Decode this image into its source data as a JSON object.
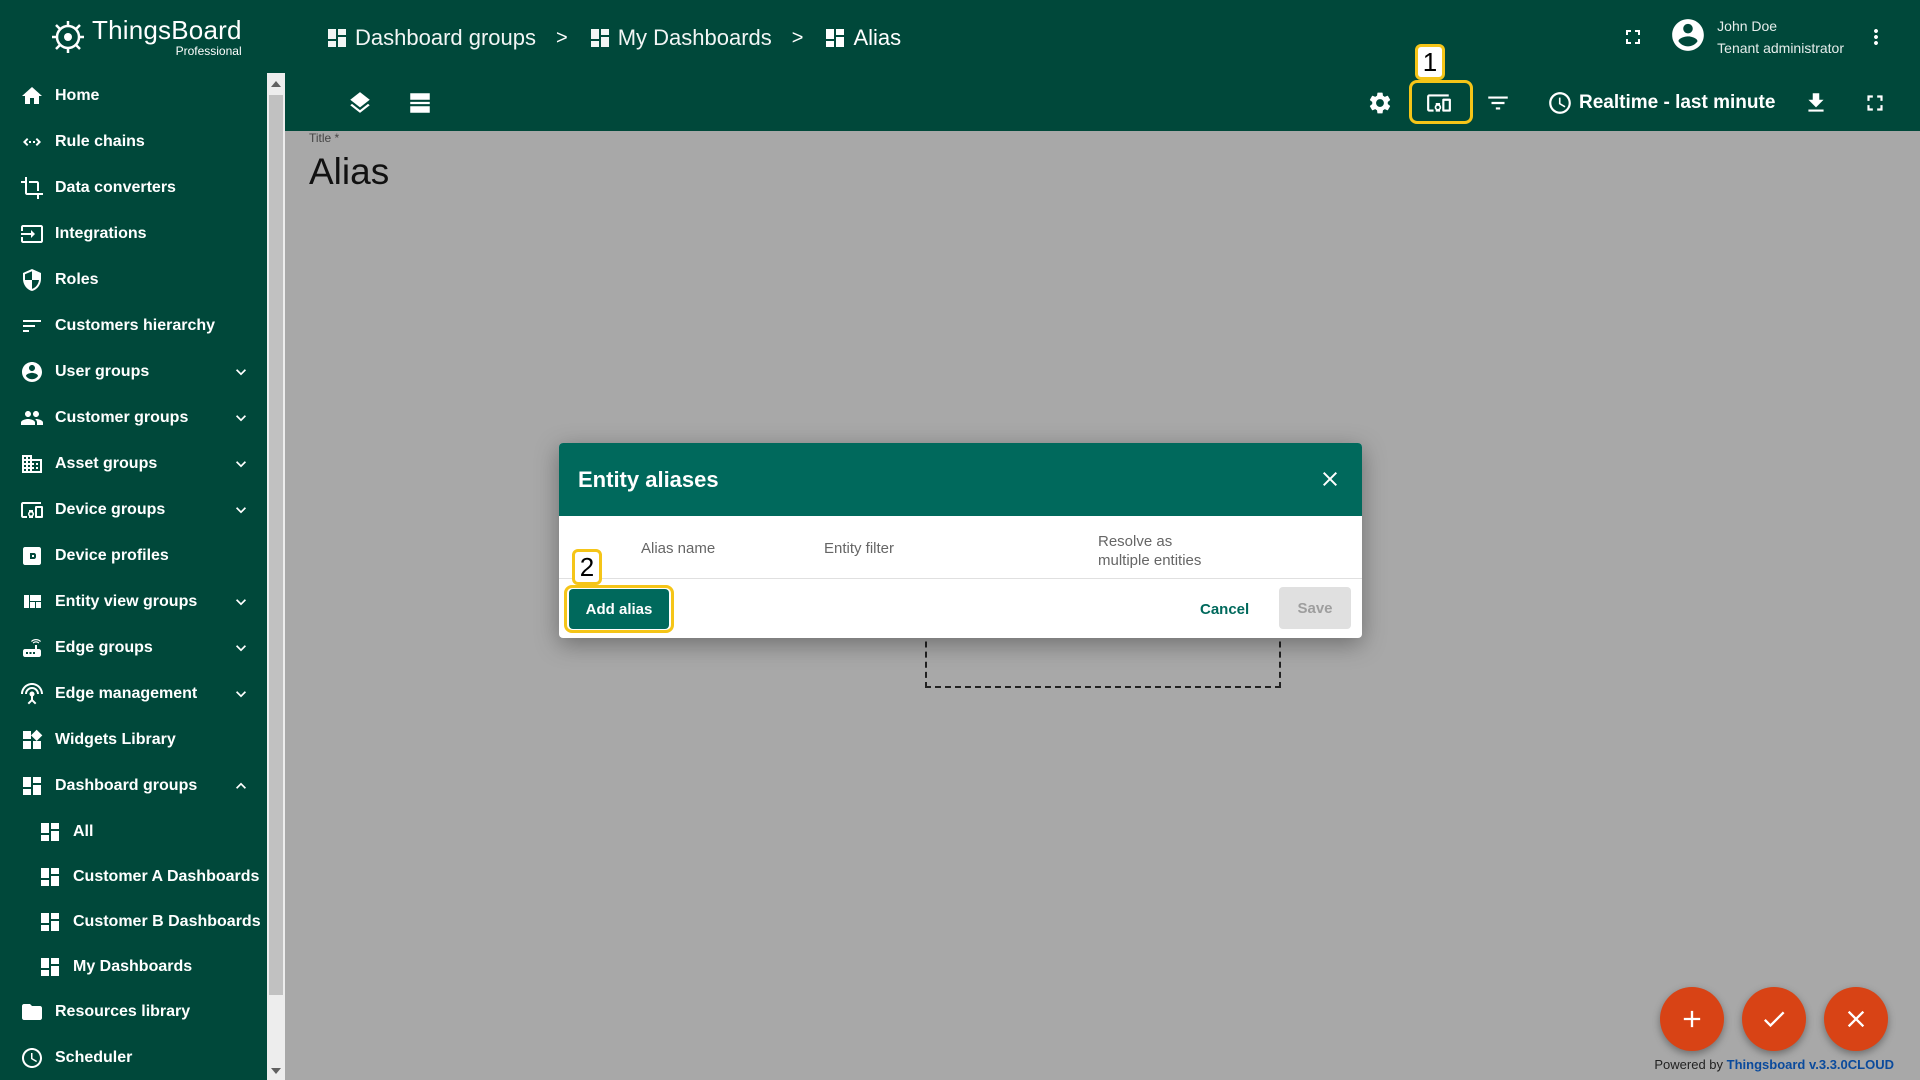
{
  "logo": {
    "name": "ThingsBoard",
    "sub": "Professional"
  },
  "sidebar": {
    "items": [
      {
        "label": "Home",
        "icon": "home-icon"
      },
      {
        "label": "Rule chains",
        "icon": "rule-chains-icon"
      },
      {
        "label": "Data converters",
        "icon": "data-converters-icon"
      },
      {
        "label": "Integrations",
        "icon": "integrations-icon"
      },
      {
        "label": "Roles",
        "icon": "shield-icon"
      },
      {
        "label": "Customers hierarchy",
        "icon": "sort-icon"
      },
      {
        "label": "User groups",
        "icon": "user-icon",
        "expandable": true
      },
      {
        "label": "Customer groups",
        "icon": "customers-icon",
        "expandable": true
      },
      {
        "label": "Asset groups",
        "icon": "building-icon",
        "expandable": true
      },
      {
        "label": "Device groups",
        "icon": "devices-icon",
        "expandable": true
      },
      {
        "label": "Device profiles",
        "icon": "device-profile-icon"
      },
      {
        "label": "Entity view groups",
        "icon": "view-quilt-icon",
        "expandable": true
      },
      {
        "label": "Edge groups",
        "icon": "router-icon",
        "expandable": true
      },
      {
        "label": "Edge management",
        "icon": "settings-input-antenna-icon",
        "expandable": true
      },
      {
        "label": "Widgets Library",
        "icon": "widgets-icon"
      },
      {
        "label": "Dashboard groups",
        "icon": "dashboard-icon",
        "expanded": true
      },
      {
        "label": "All",
        "icon": "dashboard-icon",
        "sub": true
      },
      {
        "label": "Customer A Dashboards",
        "icon": "dashboard-icon",
        "sub": true
      },
      {
        "label": "Customer B Dashboards",
        "icon": "dashboard-icon",
        "sub": true
      },
      {
        "label": "My Dashboards",
        "icon": "dashboard-icon",
        "sub": true
      },
      {
        "label": "Resources library",
        "icon": "folder-icon"
      },
      {
        "label": "Scheduler",
        "icon": "clock-icon"
      }
    ]
  },
  "breadcrumb": {
    "items": [
      "Dashboard groups",
      "My Dashboards",
      "Alias"
    ],
    "separator": ">"
  },
  "user": {
    "name": "John Doe",
    "role": "Tenant administrator"
  },
  "toolbar": {
    "timewindow": "Realtime - last minute"
  },
  "annotations": {
    "badge1": "1",
    "badge2": "2",
    "highlight_color": "#f5c518"
  },
  "content": {
    "title_label": "Title *",
    "title_value": "Alias"
  },
  "dialog": {
    "title": "Entity aliases",
    "columns": {
      "alias_name": "Alias name",
      "entity_filter": "Entity filter",
      "resolve_line1": "Resolve as",
      "resolve_line2": "multiple entities"
    },
    "add_label": "Add alias",
    "cancel_label": "Cancel",
    "save_label": "Save"
  },
  "footer": {
    "powered_prefix": "Powered by",
    "powered_link": "Thingsboard v.3.3.0CLOUD"
  },
  "colors": {
    "primary": "#00483a",
    "accent": "#00695c",
    "fab": "#d84315"
  }
}
